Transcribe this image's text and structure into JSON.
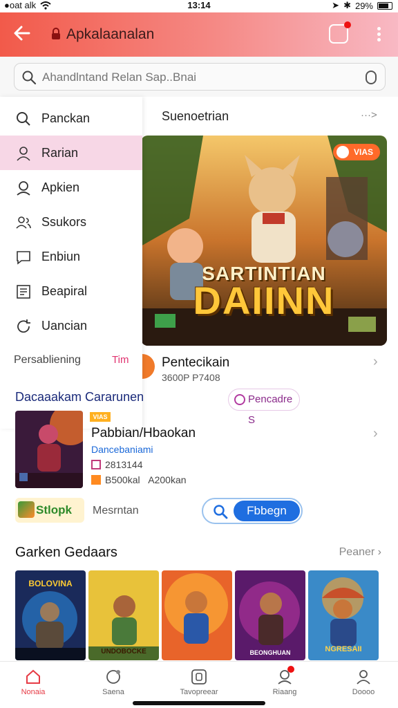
{
  "status_bar": {
    "carrier": "●oat alk",
    "time": "13:14",
    "battery": "29%"
  },
  "header": {
    "title": "Apkalaanalan",
    "back_icon": "arrow-left-icon",
    "brand_color": "#f25a4a"
  },
  "search": {
    "placeholder": "Ahandlntand Relan Sap..Bnai"
  },
  "sidebar": {
    "items": [
      {
        "label": "Panckan",
        "icon": "search-icon",
        "active": false
      },
      {
        "label": "Rarian",
        "icon": "user-icon",
        "active": true
      },
      {
        "label": "Apkien",
        "icon": "profile-icon",
        "active": false
      },
      {
        "label": "Ssukors",
        "icon": "users-icon",
        "active": false
      },
      {
        "label": "Enbiun",
        "icon": "chat-icon",
        "active": false
      },
      {
        "label": "Beapiral",
        "icon": "notes-icon",
        "active": false
      },
      {
        "label": "Uancian",
        "icon": "refresh-icon",
        "active": false
      }
    ],
    "personalizing": {
      "label": "Persabliening",
      "tag": "Tim"
    }
  },
  "featured": {
    "section_title": "Suenoetrian",
    "see_all": "···>",
    "hero": {
      "tag": "VIAS",
      "art_title_top": "SARTINTIAN",
      "art_title": "DAIINN"
    },
    "item": {
      "title": "Pentecikain",
      "meta": "3600P P7408",
      "button": "Pencadre S"
    }
  },
  "recommended": {
    "title": "Dacaaakam Cararunen",
    "item": {
      "badge": "VIAS",
      "title": "Pabbian/Hbaokan",
      "link": "Dancebaniami",
      "meta_1": "2813144",
      "meta_2": "B500kal",
      "meta_2b": "A200kan"
    },
    "logo_text": "Stlopk",
    "message": "Mesrntan",
    "button": "Fbbegn"
  },
  "grid": {
    "title": "Garken Gedaars",
    "see_all": "Peaner",
    "cards": [
      {
        "label": "BOLOVINA"
      },
      {
        "label": "UNDOBOCKE"
      },
      {
        "label": ""
      },
      {
        "label": "BEONGHUAN"
      },
      {
        "label": "NGRESAII"
      }
    ]
  },
  "bottom_nav": [
    {
      "label": "Nonaia",
      "icon": "home-icon",
      "active": true
    },
    {
      "label": "Saena",
      "icon": "search-chat-icon",
      "active": false
    },
    {
      "label": "Tavopreear",
      "icon": "square-icon",
      "active": false
    },
    {
      "label": "Riaang",
      "icon": "user-badge-icon",
      "active": false,
      "badge": true
    },
    {
      "label": "Doooo",
      "icon": "profile-icon",
      "active": false
    }
  ]
}
